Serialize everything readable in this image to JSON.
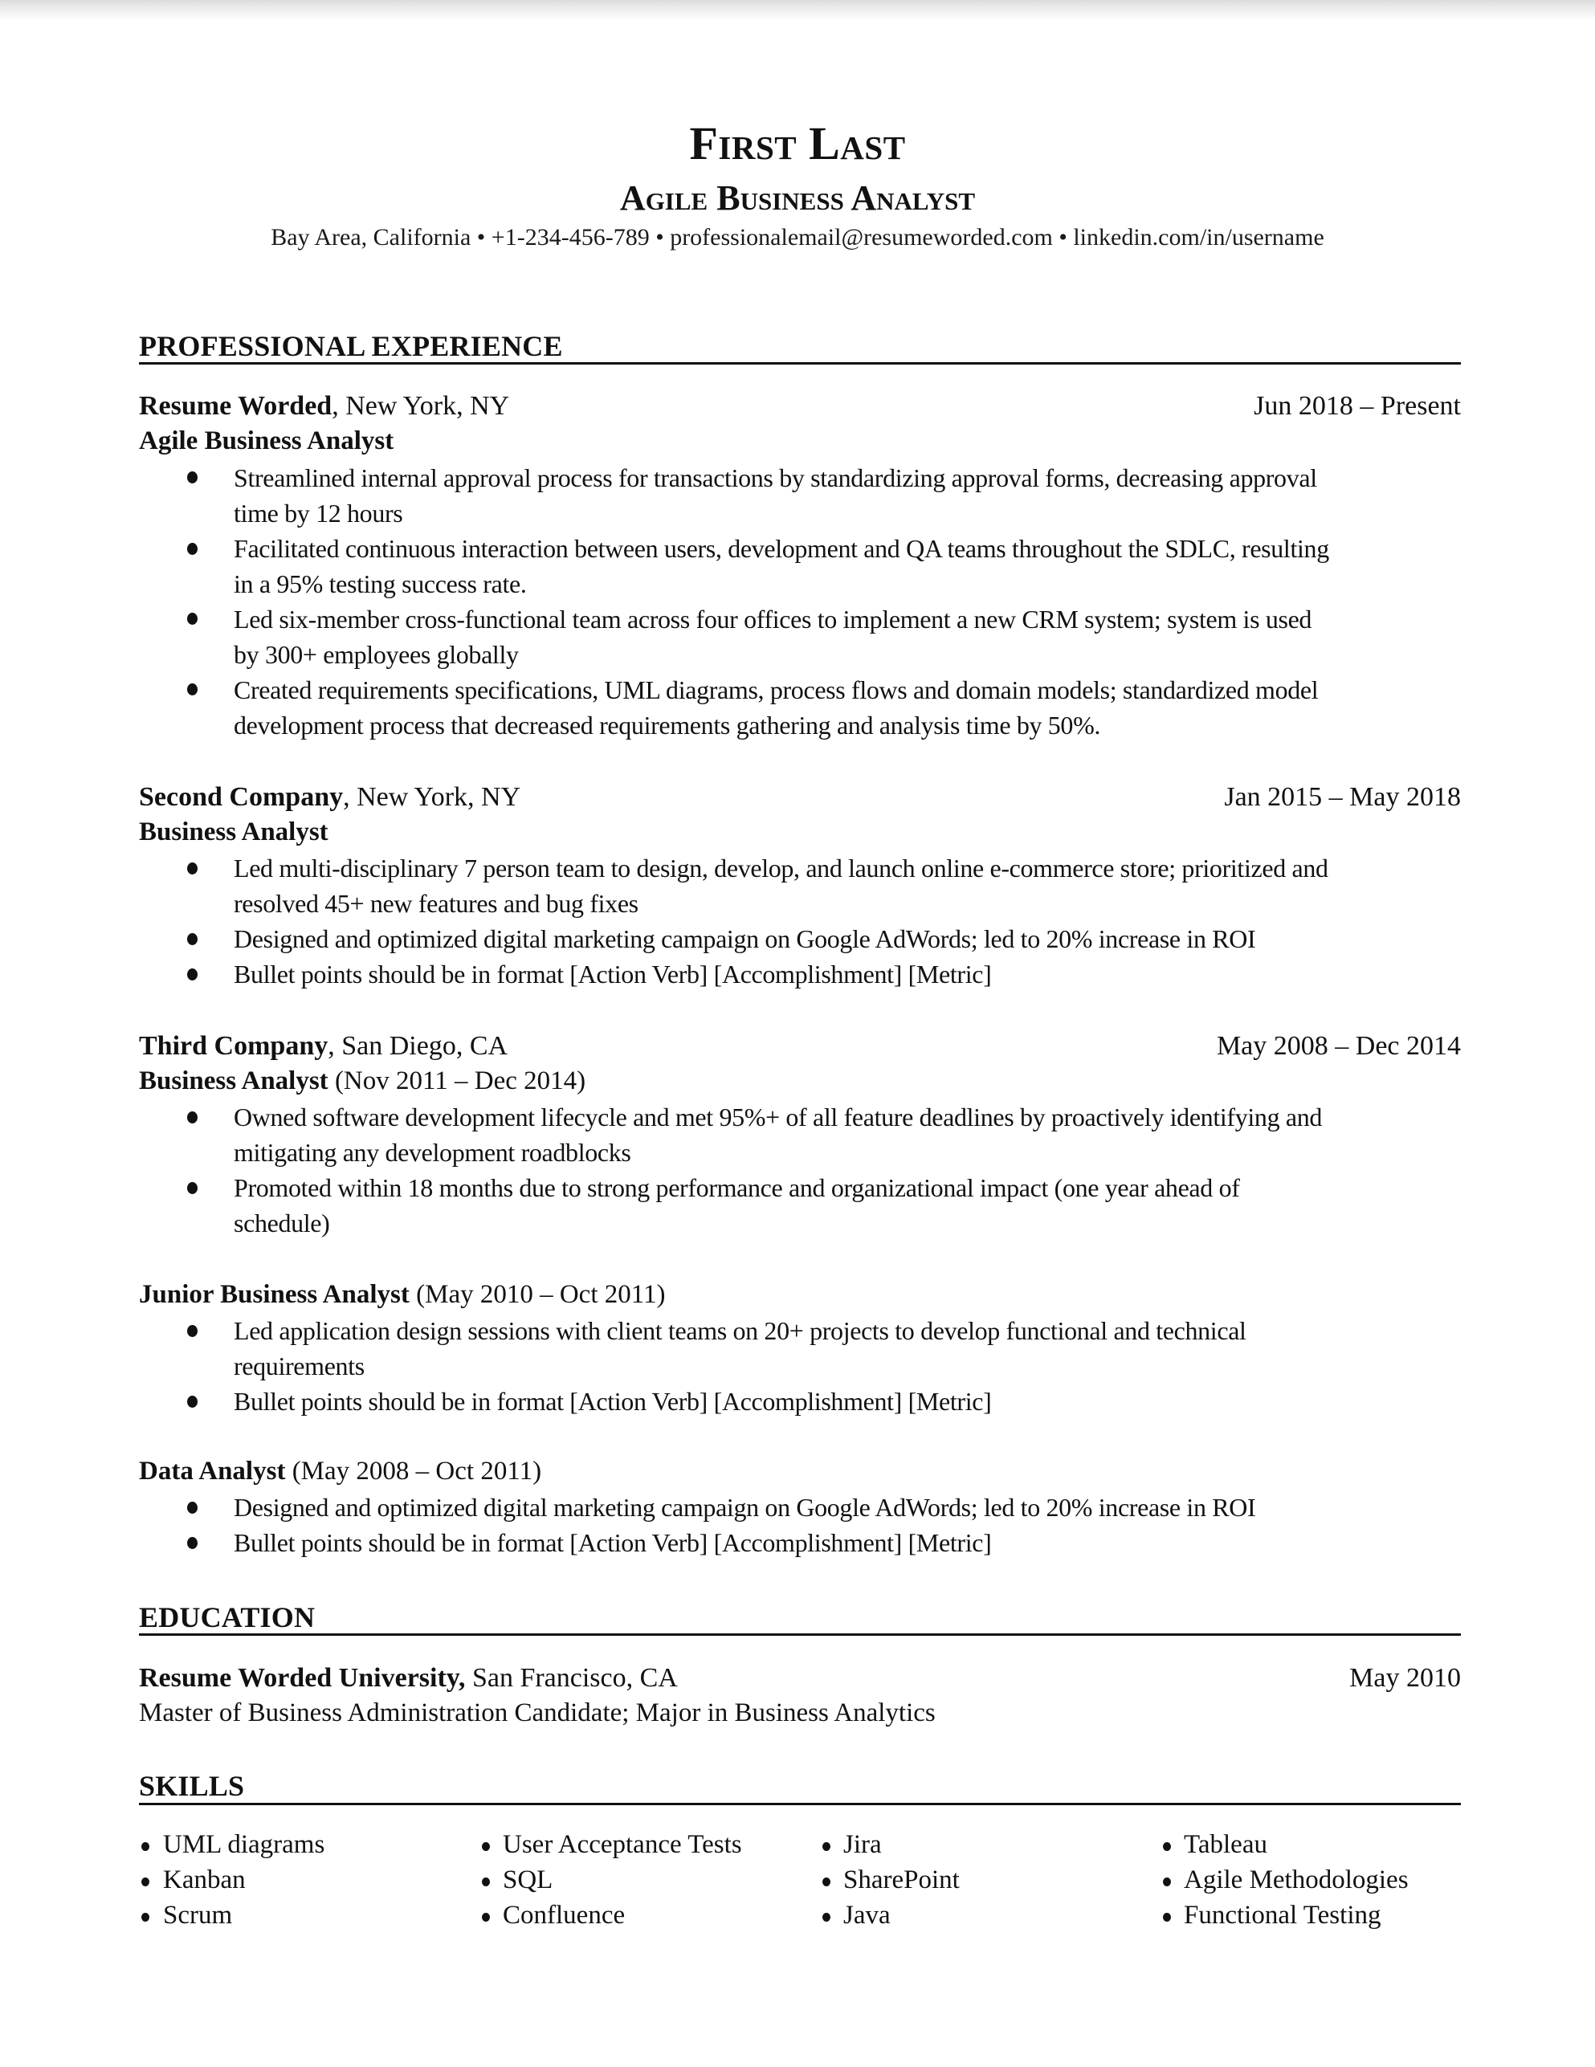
{
  "header": {
    "name": "First Last",
    "title": "Agile Business Analyst",
    "contact": "Bay Area, California • +1-234-456-789 • professionalemail@resumeworded.com • linkedin.com/in/username"
  },
  "sections": {
    "experience_heading": "PROFESSIONAL EXPERIENCE",
    "education_heading": "EDUCATION",
    "skills_heading": "SKILLS"
  },
  "experience": [
    {
      "company": "Resume Worded",
      "location": ", New York, NY",
      "dates": "Jun 2018 – Present",
      "roles": [
        {
          "title": "Agile Business Analyst",
          "period": "",
          "bullets": [
            [
              "Streamlined internal approval process for transactions by standardizing approval forms, decreasing approval",
              "time by 12 hours"
            ],
            [
              "Facilitated continuous interaction between users, development and QA teams throughout the SDLC, resulting",
              "in a 95% testing success rate."
            ],
            [
              "Led six-member cross-functional team across four offices to implement a new CRM system; system is used",
              "by 300+ employees globally"
            ],
            [
              "Created requirements specifications, UML diagrams, process flows and domain models; standardized model",
              "development process that decreased requirements gathering and analysis time by 50%."
            ]
          ]
        }
      ]
    },
    {
      "company": "Second Company",
      "location": ", New York, NY",
      "dates": "Jan 2015 – May 2018",
      "roles": [
        {
          "title": "Business Analyst",
          "period": "",
          "bullets": [
            [
              "Led multi-disciplinary 7 person team to design, develop, and launch online e-commerce store; prioritized and",
              "resolved 45+ new features and bug fixes"
            ],
            [
              "Designed and optimized digital marketing campaign on Google AdWords; led to 20% increase in ROI"
            ],
            [
              "Bullet points should be in format [Action Verb] [Accomplishment] [Metric]"
            ]
          ]
        }
      ]
    },
    {
      "company": "Third Company",
      "location": ", San Diego, CA",
      "dates": "May 2008 – Dec 2014",
      "roles": [
        {
          "title": "Business Analyst",
          "period": " (Nov 2011 – Dec 2014)",
          "bullets": [
            [
              "Owned software development lifecycle and met 95%+ of  all feature deadlines by proactively identifying and",
              "mitigating any development roadblocks"
            ],
            [
              "Promoted within 18 months due to strong performance and organizational impact (one year ahead of",
              "schedule)"
            ]
          ]
        },
        {
          "title": "Junior Business Analyst",
          "period": " (May 2010 – Oct 2011)",
          "bullets": [
            [
              "Led application design sessions with client teams on 20+ projects to develop functional and technical",
              "requirements"
            ],
            [
              "Bullet points should be in format [Action Verb] [Accomplishment] [Metric]"
            ]
          ]
        },
        {
          "title": "Data Analyst",
          "period": " (May 2008 – Oct 2011)",
          "bullets": [
            [
              "Designed and optimized digital marketing campaign on Google AdWords; led to 20% increase in ROI"
            ],
            [
              "Bullet points should be in format [Action Verb] [Accomplishment] [Metric]"
            ]
          ]
        }
      ]
    }
  ],
  "education": {
    "school": "Resume Worded University,",
    "location": " San Francisco, CA",
    "date": "May 2010",
    "degree": "Master of Business Administration Candidate; Major in Business Analytics"
  },
  "skills": [
    [
      "UML diagrams",
      "Kanban",
      "Scrum"
    ],
    [
      "User Acceptance Tests",
      "SQL",
      "Confluence"
    ],
    [
      "Jira",
      "SharePoint",
      "Java"
    ],
    [
      "Tableau",
      "Agile Methodologies",
      "Functional Testing"
    ]
  ]
}
